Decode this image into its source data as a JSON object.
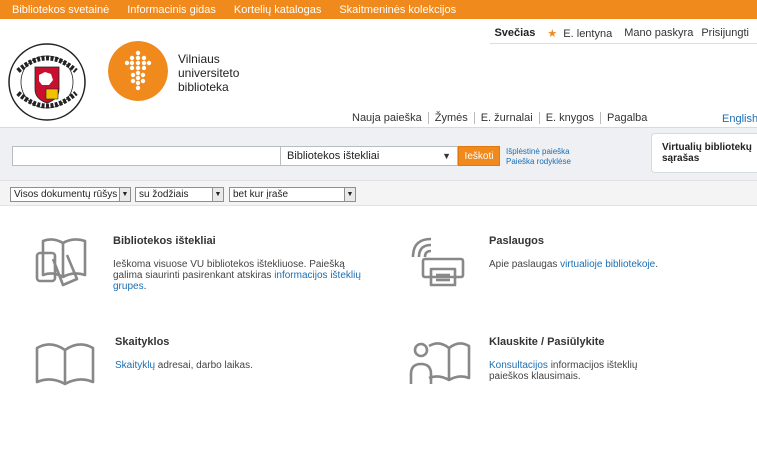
{
  "topbar": {
    "links": [
      "Bibliotekos svetainė",
      "Informacinis gidas",
      "Kortelių katalogas",
      "Skaitmeninės kolekcijos"
    ]
  },
  "user_bar": {
    "guest": "Svečias",
    "eshelf": "E. lentyna",
    "account": "Mano paskyra",
    "login": "Prisijungti"
  },
  "header": {
    "library_name": [
      "Vilniaus",
      "universiteto",
      "biblioteka"
    ]
  },
  "main_nav": {
    "items": [
      "Nauja paieška",
      "Žymės",
      "E. žurnalai",
      "E. knygos",
      "Pagalba"
    ],
    "language": "English"
  },
  "search": {
    "query": "",
    "scope": "Bibliotekos ištekliai",
    "button": "Ieškoti",
    "advanced": "Išplėstinė paieška",
    "indexes": "Paieška rodyklėse",
    "virtual_shelf": [
      "Virtualių bibliotekų",
      "sąrašas"
    ]
  },
  "filters": {
    "doc_type": "Visos dokumentų rūšys",
    "match": "su žodžiais",
    "field": "bet kur įraše"
  },
  "cards": {
    "resources": {
      "title": "Bibliotekos ištekliai",
      "text": "Ieškoma visuose VU bibliotekos ištekliuose. Paiešką galima siaurinti pasirenkant atskiras",
      "link": "informacijos išteklių grupes",
      "tail": "."
    },
    "services": {
      "title": "Paslaugos",
      "text": "Apie paslaugas",
      "link": "virtualioje bibliotekoje",
      "tail": "."
    },
    "reading_rooms": {
      "title": "Skaityklos",
      "link": "Skaityklų",
      "text": " adresai, darbo laikas."
    },
    "ask": {
      "title": "Klauskite / Pasiūlykite",
      "link": "Konsultacijos",
      "text": " informacijos išteklių paieškos klausimais."
    }
  },
  "colors": {
    "brand_orange": "#f08a1d",
    "link_blue": "#1a6fb4"
  }
}
